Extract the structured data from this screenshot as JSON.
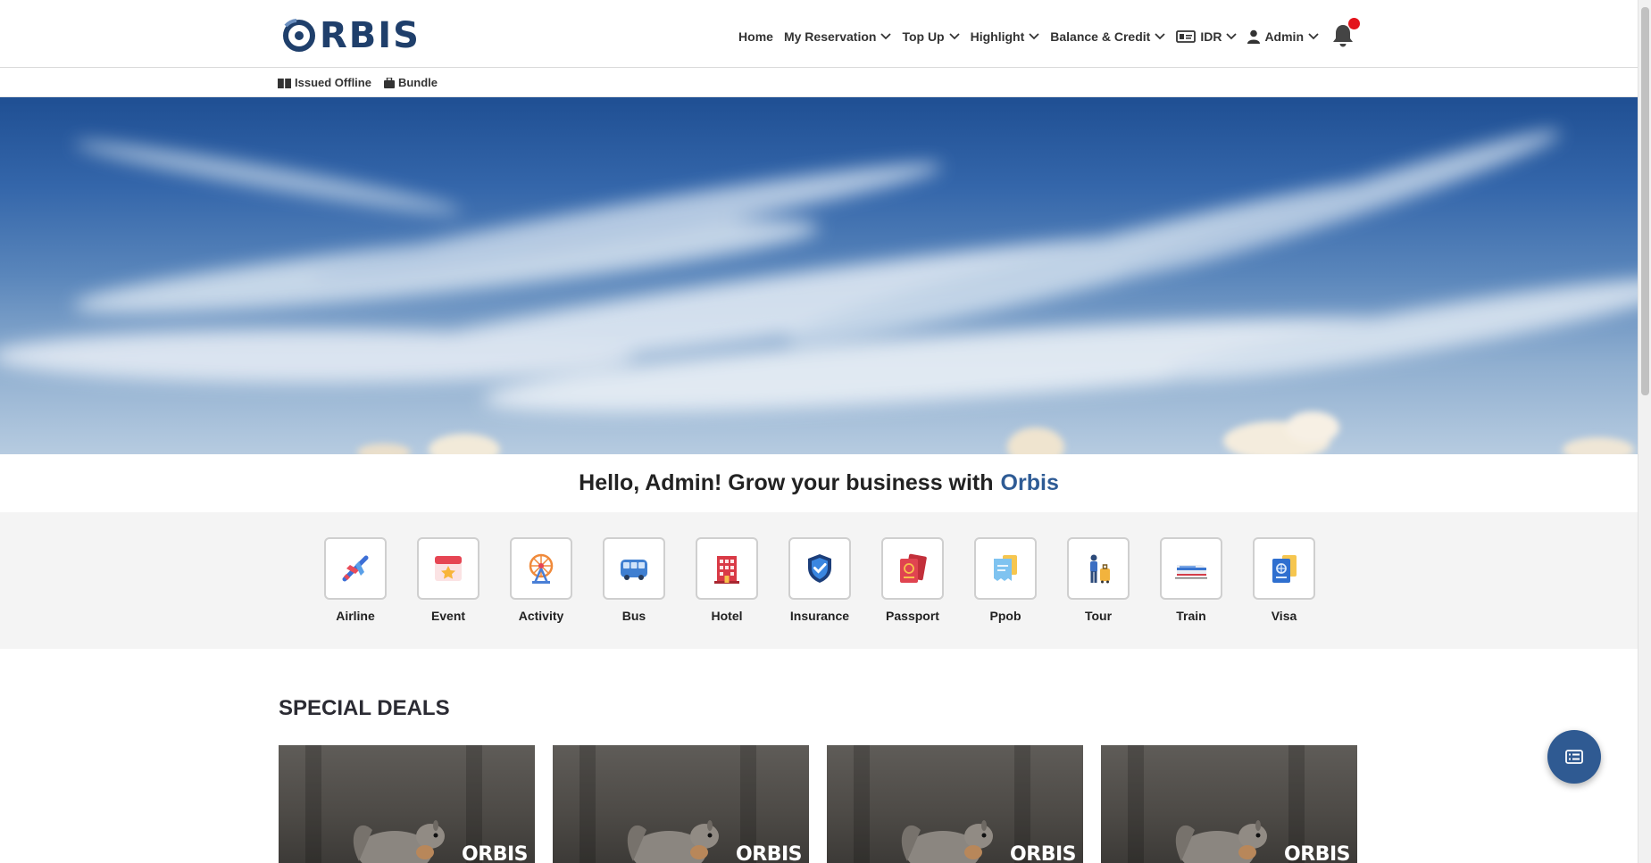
{
  "header": {
    "logo_text": "RBIS",
    "nav": [
      {
        "label": "Home"
      },
      {
        "label": "My Reservation"
      },
      {
        "label": "Top Up"
      },
      {
        "label": "Highlight"
      },
      {
        "label": "Balance & Credit"
      },
      {
        "label": "IDR"
      },
      {
        "label": "Admin"
      }
    ]
  },
  "subnav": {
    "issued_offline": "Issued Offline",
    "bundle": "Bundle"
  },
  "greeting": {
    "text": "Hello, Admin! Grow your business with",
    "brand": "Orbis"
  },
  "services": [
    {
      "label": "Airline",
      "icon": "airplane-icon"
    },
    {
      "label": "Event",
      "icon": "calendar-star-icon"
    },
    {
      "label": "Activity",
      "icon": "ferris-wheel-icon"
    },
    {
      "label": "Bus",
      "icon": "bus-icon"
    },
    {
      "label": "Hotel",
      "icon": "hotel-icon"
    },
    {
      "label": "Insurance",
      "icon": "shield-check-icon"
    },
    {
      "label": "Passport",
      "icon": "passport-icon"
    },
    {
      "label": "Ppob",
      "icon": "receipt-icon"
    },
    {
      "label": "Tour",
      "icon": "traveler-icon"
    },
    {
      "label": "Train",
      "icon": "train-icon"
    },
    {
      "label": "Visa",
      "icon": "visa-icon"
    }
  ],
  "deals": {
    "title": "SPECIAL DEALS",
    "watermark": "ORBIS"
  },
  "colors": {
    "brand": "#2e5b95",
    "logo": "#1f3f6b",
    "notification": "#e3131b"
  }
}
